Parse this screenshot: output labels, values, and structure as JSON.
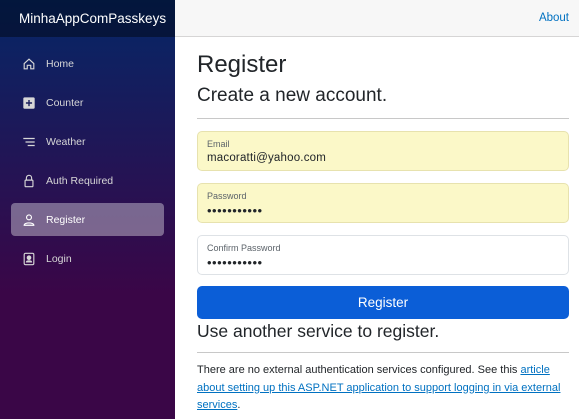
{
  "sidebar": {
    "brand": "MinhaAppComPasskeys",
    "items": [
      {
        "label": "Home",
        "icon": "house-icon"
      },
      {
        "label": "Counter",
        "icon": "plus-square-icon"
      },
      {
        "label": "Weather",
        "icon": "list-icon"
      },
      {
        "label": "Auth Required",
        "icon": "lock-icon"
      },
      {
        "label": "Register",
        "icon": "person-icon",
        "active": true
      },
      {
        "label": "Login",
        "icon": "person-badge-icon"
      }
    ]
  },
  "header": {
    "about": "About"
  },
  "main": {
    "title": "Register",
    "subtitle": "Create a new account.",
    "email": {
      "label": "Email",
      "value": "macoratti@yahoo.com"
    },
    "password": {
      "label": "Password",
      "value": "•••••••••••"
    },
    "confirm_password": {
      "label": "Confirm Password",
      "value": "•••••••••••"
    },
    "register_button": "Register",
    "external_title": "Use another service to register.",
    "info_prefix": "There are no external authentication services configured. See this ",
    "info_link": "article about setting up this ASP.NET application to support logging in via external services",
    "info_suffix": "."
  },
  "colors": {
    "sidebar_top": "#052767",
    "sidebar_bottom": "#3a0647",
    "accent": "#0b5ed7",
    "autofill": "#fbf8c8",
    "link": "#0071c1"
  }
}
